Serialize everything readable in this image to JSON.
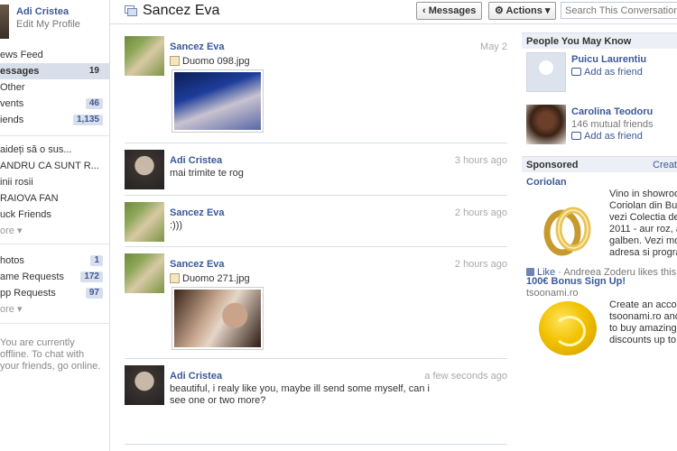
{
  "sidebar": {
    "profile": {
      "name": "Adi Cristea",
      "edit_label": "Edit My Profile"
    },
    "items": [
      {
        "label": "ews Feed",
        "count": ""
      },
      {
        "label": "essages",
        "count": "19"
      },
      {
        "label": "Other",
        "count": ""
      },
      {
        "label": "vents",
        "count": "46"
      },
      {
        "label": "iends",
        "count": "1,135"
      }
    ],
    "groups": [
      "aideți să o sus...",
      "ANDRU CA SUNT R...",
      "inii rosii",
      "RAIOVA FAN",
      "uck Friends",
      "ore ▾"
    ],
    "apps": [
      {
        "label": "hotos",
        "count": "1"
      },
      {
        "label": "ame Requests",
        "count": "172"
      },
      {
        "label": "pp Requests",
        "count": "97"
      },
      {
        "label": "ore ▾",
        "count": ""
      }
    ],
    "offline_text": "You are currently offline. To chat with your friends, go online."
  },
  "header": {
    "title": "Sancez Eva",
    "messages_button": "‹ Messages",
    "actions_button": "⚙ Actions ▾",
    "search_placeholder": "Search This Conversation"
  },
  "messages": [
    {
      "sender": "Sancez Eva",
      "time": "May 2",
      "attachment": "Duomo 098.jpg",
      "text": ""
    },
    {
      "sender": "Adi Cristea",
      "time": "3 hours ago",
      "attachment": "",
      "text": "mai trimite te rog"
    },
    {
      "sender": "Sancez Eva",
      "time": "2 hours ago",
      "attachment": "",
      "text": ":)))"
    },
    {
      "sender": "Sancez Eva",
      "time": "2 hours ago",
      "attachment": "Duomo 271.jpg",
      "text": ""
    },
    {
      "sender": "Adi Cristea",
      "time": "a few seconds ago",
      "attachment": "",
      "text": "beautiful, i realy like you, maybe ill send some myself, can i see one or two more?"
    }
  ],
  "right": {
    "pymk_title": "People You May Know",
    "people": [
      {
        "name": "Puicu Laurentiu",
        "mutual": "",
        "add_label": "Add as friend"
      },
      {
        "name": "Carolina Teodoru",
        "mutual": "146 mutual friends",
        "add_label": "Add as friend"
      }
    ],
    "sponsored_title": "Sponsored",
    "create_label": "Creat",
    "ads": [
      {
        "title": "Coriolan",
        "url": "",
        "body": "Vino in showroom-\nCoriolan din Bucur\nvezi Colectia de Ve\n2011 - aur roz, alb\ngalben. Vezi mode\nadresa si program",
        "like_label": "Like",
        "like_text": " · Andreea Zoderu likes this."
      },
      {
        "title": "100€ Bonus Sign Up!",
        "url": "tsoonami.ro",
        "body": "Create an account\ntsoonami.ro and g\nto buy amazing de\ndiscounts up to 90",
        "like_label": "",
        "like_text": ""
      }
    ]
  },
  "colors": {
    "link": "#3b5998",
    "nav_selected": "#d8dfea",
    "badge_bg": "#d8dfea"
  }
}
